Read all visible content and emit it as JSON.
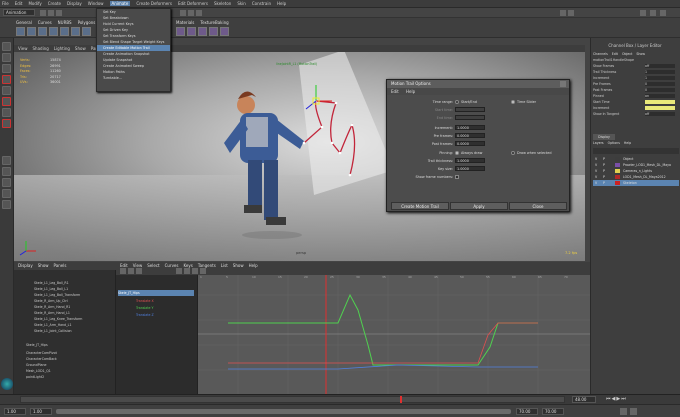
{
  "menubar": {
    "items": [
      "File",
      "Edit",
      "Modify",
      "Create",
      "Display",
      "Window",
      "Animate",
      "Create Deformers",
      "Edit Deformers",
      "Skeleton",
      "Skin",
      "Constrain",
      "Help"
    ],
    "active_index": 6
  },
  "shelf": {
    "tabs": [
      "General",
      "Curves",
      "NURBS",
      "Polygons"
    ],
    "extra_tabs": [
      "Materials",
      "TextureBaking"
    ],
    "mode_selector": "Animation"
  },
  "viewport": {
    "menu": [
      "View",
      "Shading",
      "Lighting",
      "Show",
      "Panels"
    ],
    "hud": [
      {
        "label": "Verts:",
        "value": "15874"
      },
      {
        "label": "Edges:",
        "value": "26991"
      },
      {
        "label": "Faces:",
        "value": "11260"
      },
      {
        "label": "Tris:",
        "value": "20717"
      },
      {
        "label": "UVs:",
        "value": "36001"
      }
    ],
    "camera_label": "persp",
    "fps_label": "7.2 fps",
    "handle_label": "lineJointR_L1 (MotionTrail)"
  },
  "animate_menu": {
    "items": [
      "Set Key",
      "Set Breakdown",
      "Hold Current Keys",
      "Set Driven Key",
      "Set Transform Keys",
      "Set Blend Shape Target Weight Keys",
      "Create Editable Motion Trail",
      "Create Animation Snapshot",
      "Update Snapshot",
      "Create Animated Sweep",
      "Motion Paths",
      "Turntable..."
    ],
    "highlighted_index": 6
  },
  "dialog": {
    "title": "Motion Trail Options",
    "menu": [
      "Edit",
      "Help"
    ],
    "time_range_label": "Time range:",
    "time_range_options": [
      "Start/End",
      "Time Slider"
    ],
    "time_range_selected": 1,
    "start_time_label": "Start time:",
    "end_time_label": "End time:",
    "increment_label": "Increment:",
    "increment_value": "1.0000",
    "pre_frames_label": "Pre frames:",
    "pre_frames_value": "0.0000",
    "post_frames_label": "Post frames:",
    "post_frames_value": "0.0000",
    "pinning_label": "Pinning:",
    "pinning_options": [
      "Always draw",
      "Draw when selected"
    ],
    "pinning_selected": 0,
    "trail_thickness_label": "Trail thickness:",
    "trail_thickness_value": "1.0000",
    "key_size_label": "Key size:",
    "key_size_value": "1.0000",
    "show_frame_numbers_label": "Show frame numbers:",
    "buttons": [
      "Create Motion Trail",
      "Apply",
      "Close"
    ]
  },
  "channel_box": {
    "title": "Channel Box / Layer Editor",
    "menu": [
      "Channels",
      "Edit",
      "Object",
      "Show"
    ],
    "node": "motionTrail1HandleShape",
    "attributes": [
      {
        "name": "Show Frames",
        "value": "off"
      },
      {
        "name": "Trail Thickness",
        "value": "1"
      },
      {
        "name": "Increment",
        "value": "1"
      },
      {
        "name": "Pre Frames",
        "value": "0"
      },
      {
        "name": "Post Frames",
        "value": "0"
      },
      {
        "name": "Pinned",
        "value": "on"
      },
      {
        "name": "Start Time",
        "value": ""
      },
      {
        "name": "Increment",
        "value": ""
      },
      {
        "name": "Show In Tangent",
        "value": "off"
      }
    ],
    "tabs": [
      "Display"
    ],
    "layer_menu": [
      "Layers",
      "Options",
      "Help"
    ],
    "layers": [
      {
        "name": "Object",
        "color": "#3d3d3d",
        "selected": false
      },
      {
        "name": "Prowler_LOD1_Mesh_DL_Maya",
        "color": "#7a4fa8",
        "selected": false
      },
      {
        "name": "Cameras_n_Lights",
        "color": "#e0d050",
        "selected": false
      },
      {
        "name": "LOD1_Mesh_DL_Maya2012",
        "color": "#b02828",
        "selected": false
      },
      {
        "name": "Skeleton",
        "color": "#c22",
        "selected": true
      }
    ]
  },
  "outliner": {
    "menu": [
      "Display",
      "Show",
      "Panels"
    ],
    "items": [
      "Skele_L1_Leg_Ball_R1",
      "Skele_L1_Leg_Ball_L1",
      "Skele_L1_Leg_Ball_Transform",
      "Skele_R_Arm_Up_Ctrl",
      "Skele_R_Arm_Hand_R1",
      "Skele_R_Arm_Hand_L1",
      "Skele_L1_Leg_Knee_Transform",
      "Skele_L1_Arm_Hand_L1",
      "Skele_L1_Joint_Collision",
      "Skele_JT_Hips",
      "CharacterCamPivot",
      "CharacterCamBack",
      "GroundPlane",
      "Mesh_LOD1_Q1",
      "pointLight2"
    ]
  },
  "graph_editor": {
    "menu": [
      "Edit",
      "View",
      "Select",
      "Curves",
      "Keys",
      "Tangents",
      "List",
      "Show",
      "Help"
    ],
    "list": [
      {
        "name": "Skele_JT_Hips",
        "color": "#ddd"
      },
      {
        "name": "Translate X",
        "color": "#e05050"
      },
      {
        "name": "Translate Y",
        "color": "#50d050"
      },
      {
        "name": "Translate Z",
        "color": "#5080e0"
      }
    ],
    "ruler": [
      "1",
      "5",
      "10",
      "15",
      "20",
      "25",
      "30",
      "35",
      "40",
      "45",
      "50",
      "55",
      "60",
      "65",
      "70"
    ]
  },
  "timeline": {
    "current_frame": "48.00",
    "start": "1.00",
    "end": "70.00",
    "range_start": "1.00",
    "range_end": "70.00"
  },
  "colors": {
    "accent": "#5b84b1",
    "motion_trail": "#c2253a",
    "curve_green": "#50d050",
    "curve_red": "#e05050",
    "curve_blue": "#5080e0"
  }
}
